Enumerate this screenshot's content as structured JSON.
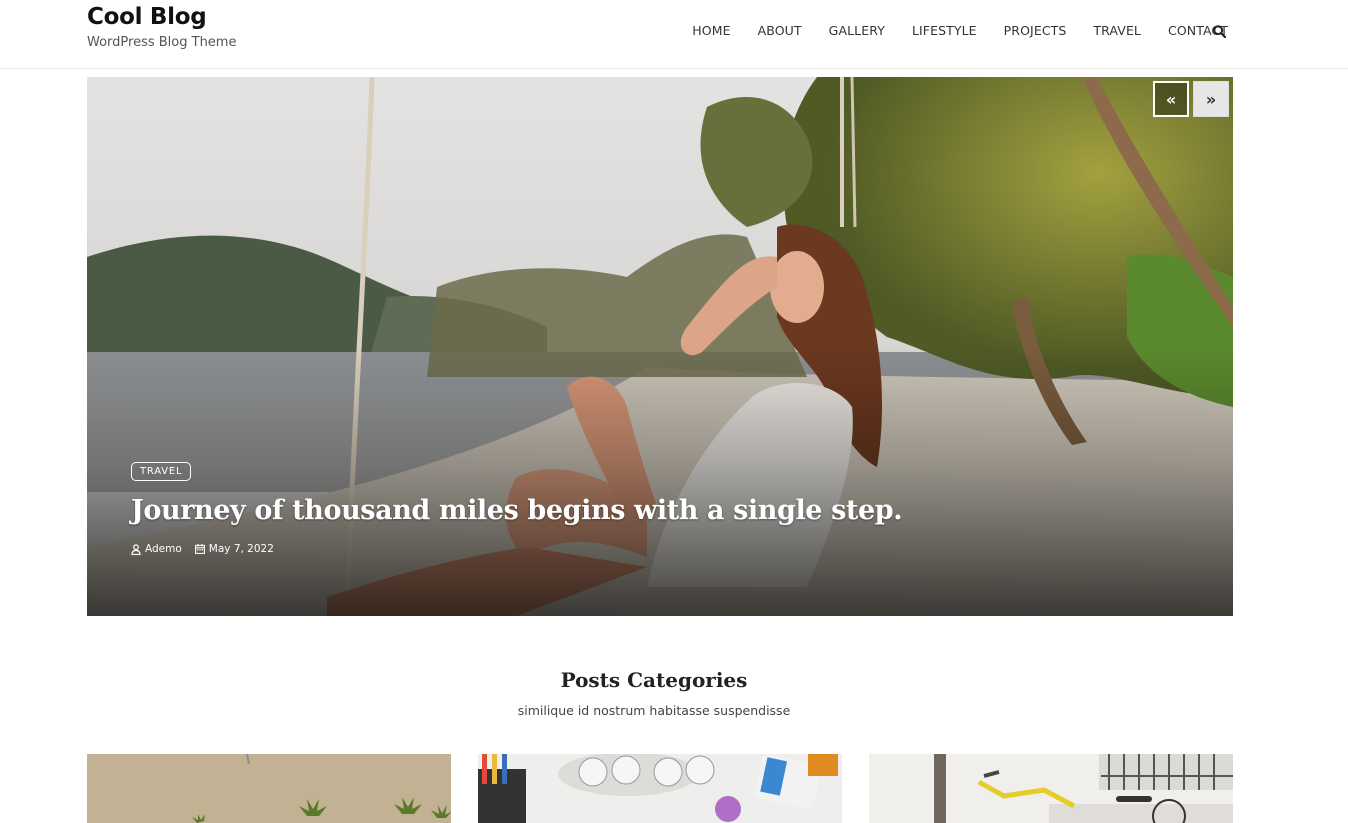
{
  "site": {
    "title": "Cool Blog",
    "tagline": "WordPress Blog Theme"
  },
  "nav": {
    "items": [
      "HOME",
      "ABOUT",
      "GALLERY",
      "LIFESTYLE",
      "PROJECTS",
      "TRAVEL",
      "CONTACT"
    ],
    "search_icon": "search-icon"
  },
  "hero": {
    "prev_label": "«",
    "next_label": "»",
    "category": "TRAVEL",
    "title": "Journey of thousand miles begins with a single step.",
    "author": "Ademo",
    "date": "May 7, 2022",
    "author_icon": "user-icon",
    "date_icon": "calendar-icon"
  },
  "categories_section": {
    "title": "Posts Categories",
    "subtitle": "similique id nostrum habitasse suspendisse"
  },
  "category_cards": [
    "beach-palms-image",
    "stationery-desk-image",
    "bicycle-street-image"
  ]
}
